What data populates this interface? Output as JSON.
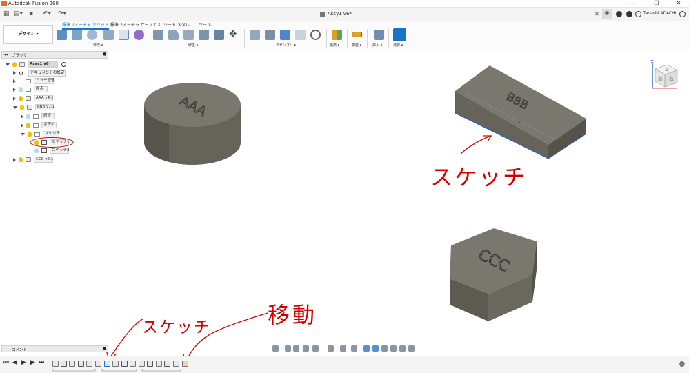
{
  "window": {
    "app_title": "Autodesk Fusion 360",
    "doc_title": "Assy1 v6*",
    "user": "Tadashi ADACHI",
    "controls": [
      "—",
      "❐",
      "✕"
    ]
  },
  "ribbon": {
    "workspace_button": "デザイン ▾",
    "tabs": [
      "標準フィーチャ ソリッド",
      "標準フィーチャ サーフェス",
      "シート メタル",
      "ツール"
    ],
    "active_tab": 0,
    "groups": [
      "作成 ▾",
      "修正 ▾",
      "アセンブリ ▾",
      "構築 ▾",
      "検査 ▾",
      "挿入 ▾",
      "選択 ▾"
    ]
  },
  "browser": {
    "header": "ブラウザ",
    "root": "Assy1 v6",
    "items": [
      {
        "label": "ドキュメントの設定"
      },
      {
        "label": "ビュー管理"
      },
      {
        "label": "原点"
      },
      {
        "label": "AAA v4:1"
      },
      {
        "label": "BBB v1:1"
      },
      {
        "label": "原点"
      },
      {
        "label": "ボディ"
      },
      {
        "label": "スケッチ"
      },
      {
        "label": "スケッチ1"
      },
      {
        "label": "スケッチ2"
      },
      {
        "label": "CCC v2:1"
      }
    ]
  },
  "comment_panel": {
    "header": "コメント"
  },
  "viewport": {
    "objects": [
      {
        "name": "cylinder",
        "engraving": "AAA"
      },
      {
        "name": "box",
        "engraving": "BBB"
      },
      {
        "name": "hexagon",
        "engraving": "CCC"
      }
    ],
    "viewcube": {
      "top": "上",
      "front": "前",
      "right": "右"
    },
    "axis": "Z"
  },
  "annotations": {
    "sketch_right": "スケッチ",
    "sketch_bottom": "スケッチ",
    "move": "移動"
  },
  "colors": {
    "accent": "#1a73c8",
    "model_body": "#6f6c62",
    "annotation_red": "#d40000",
    "selected_edge": "#1f5fd6"
  }
}
